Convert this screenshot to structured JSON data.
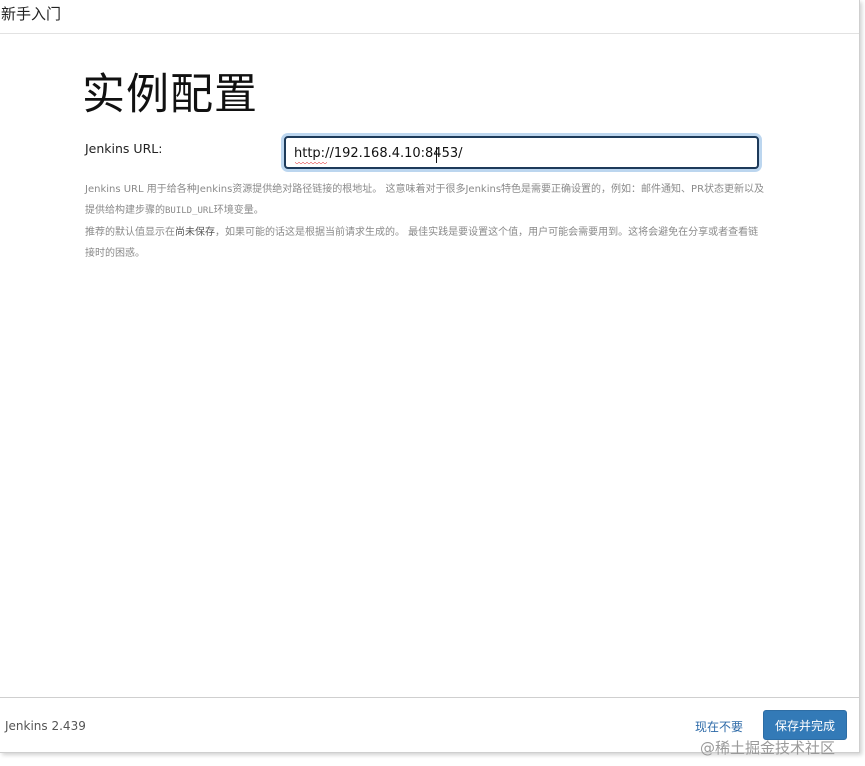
{
  "header": {
    "title": "新手入门"
  },
  "main": {
    "title": "实例配置",
    "url_label": "Jenkins URL:",
    "url_value": "http://192.168.4.10:8453/",
    "help": {
      "p1a": "Jenkins URL 用于给各种Jenkins资源提供绝对路径链接的根地址。 这意味着对于很多Jenkins特色是需要正确设置的，例如：邮件通知、PR状态更新以及提供给构建步骤的",
      "p1_code": "BUILD_URL",
      "p1b": "环境变量。",
      "p2a": "推荐的默认值显示在",
      "p2_em": "尚未保存",
      "p2b": "，如果可能的话这是根据当前请求生成的。 最佳实践是要设置这个值，用户可能会需要用到。这将会避免在分享或者查看链接时的困惑。"
    }
  },
  "footer": {
    "version": "Jenkins 2.439",
    "skip_label": "现在不要",
    "finish_label": "保存并完成"
  },
  "watermark": "@稀土掘金技术社区",
  "colors": {
    "primary_button": "#337ab7",
    "link": "#2d6aa8",
    "help_text": "#8a8a8a"
  }
}
